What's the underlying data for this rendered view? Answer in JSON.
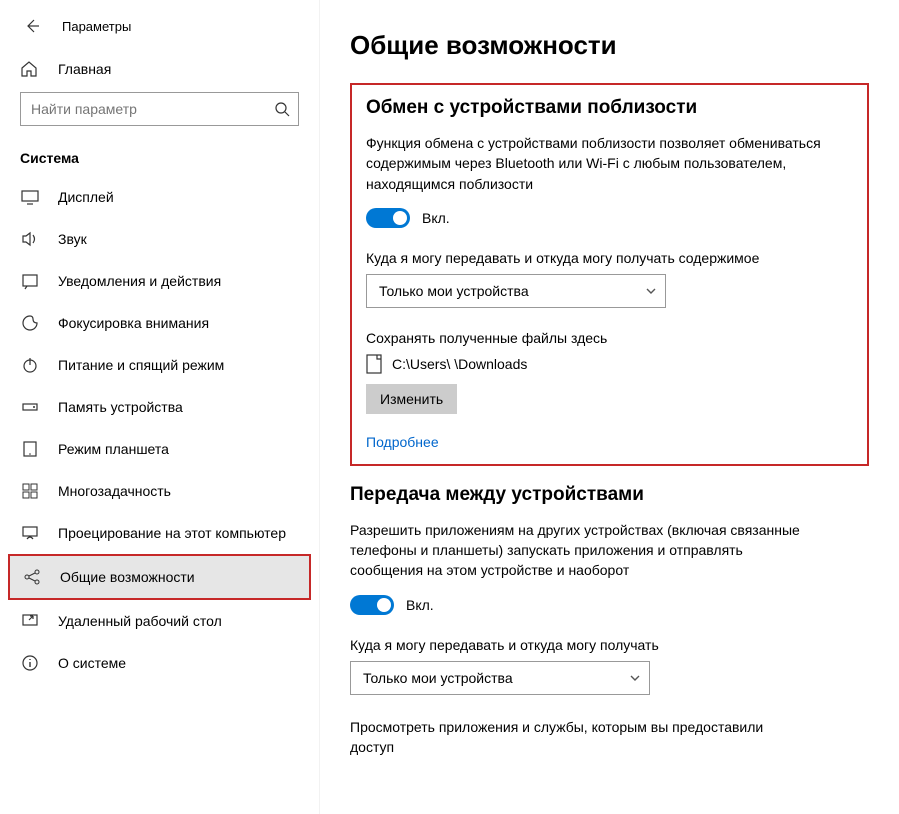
{
  "header": {
    "settings_label": "Параметры"
  },
  "home": {
    "label": "Главная"
  },
  "search": {
    "placeholder": "Найти параметр"
  },
  "group": {
    "title": "Система"
  },
  "nav": {
    "display": "Дисплей",
    "sound": "Звук",
    "notifications": "Уведомления и действия",
    "focus": "Фокусировка внимания",
    "power": "Питание и спящий режим",
    "storage": "Память устройства",
    "tablet": "Режим планшета",
    "multitask": "Многозадачность",
    "projecting": "Проецирование на этот компьютер",
    "shared": "Общие возможности",
    "remote": "Удаленный рабочий стол",
    "about": "О системе"
  },
  "main": {
    "title": "Общие возможности",
    "section1": {
      "title": "Обмен с устройствами поблизости",
      "desc": "Функция обмена с устройствами поблизости позволяет обмениваться содержимым через Bluetooth или Wi-Fi с любым пользователем, находящимся поблизости",
      "toggle_label": "Вкл.",
      "share_label": "Куда я могу передавать и откуда могу получать содержимое",
      "dropdown_value": "Только мои устройства",
      "save_label": "Сохранять полученные файлы здесь",
      "path": "C:\\Users\\          \\Downloads",
      "change_btn": "Изменить",
      "more_link": "Подробнее"
    },
    "section2": {
      "title": "Передача между устройствами",
      "desc": "Разрешить приложениям на других устройствах (включая связанные телефоны и планшеты) запускать приложения и отправлять сообщения на этом устройстве и наоборот",
      "toggle_label": "Вкл.",
      "share_label": "Куда я могу передавать и откуда могу получать",
      "dropdown_value": "Только мои устройства",
      "footer": "Просмотреть приложения и службы, которым вы предоставили доступ"
    }
  }
}
